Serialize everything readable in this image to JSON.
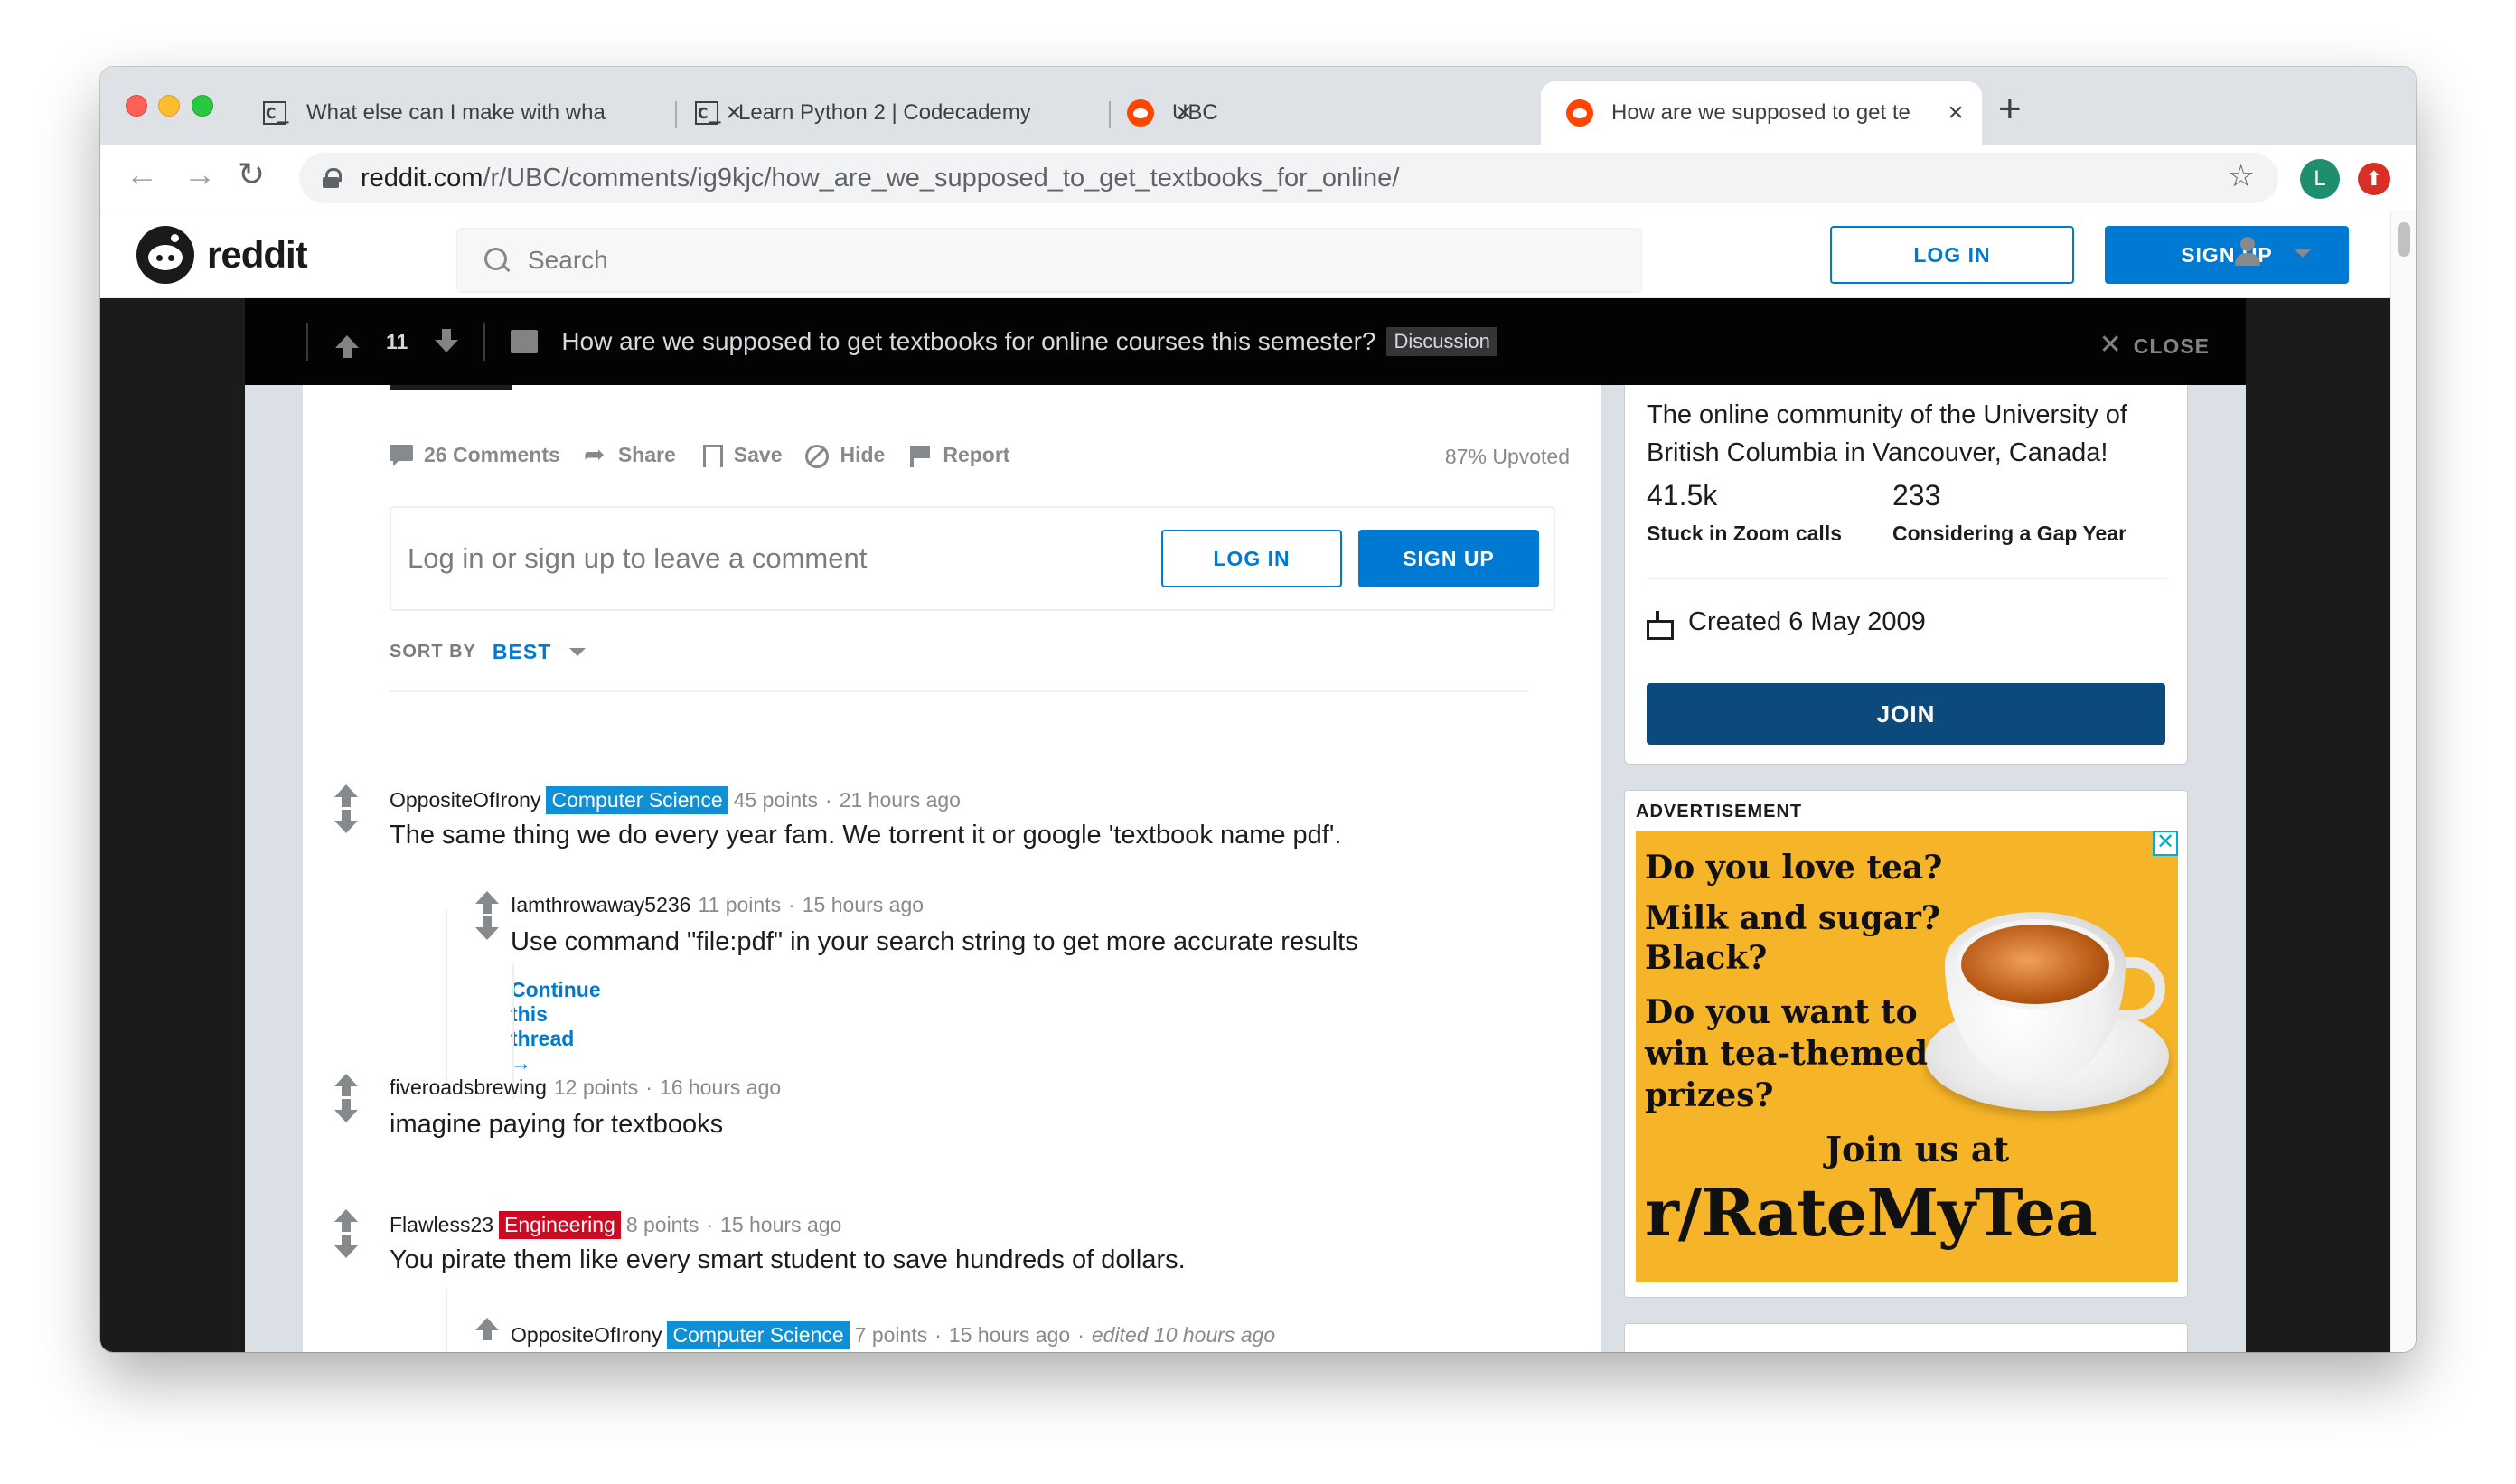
{
  "browser": {
    "tabs": [
      {
        "title": "What else can I make with wha",
        "favicon": "codecademy-icon",
        "active": false
      },
      {
        "title": "Learn Python 2 | Codecademy",
        "favicon": "codecademy-icon",
        "active": false
      },
      {
        "title": "UBC",
        "favicon": "reddit-icon",
        "active": false
      },
      {
        "title": "How are we supposed to get te",
        "favicon": "reddit-icon",
        "active": true
      }
    ],
    "favicon_text": "c_",
    "new_tab": "+",
    "url_host": "reddit.com",
    "url_path": "/r/UBC/comments/ig9kjc/how_are_we_supposed_to_get_textbooks_for_online/",
    "profile_initial": "L"
  },
  "header": {
    "logo_text": "reddit",
    "search_placeholder": "Search",
    "login_label": "LOG IN",
    "signup_label": "SIGN UP"
  },
  "post_bar": {
    "score": "11",
    "title": "How are we supposed to get textbooks for online courses this semester?",
    "flair": "Discussion",
    "close_label": "CLOSE"
  },
  "post_actions": {
    "comments": "26 Comments",
    "share": "Share",
    "save": "Save",
    "hide": "Hide",
    "report": "Report",
    "upvoted": "87% Upvoted"
  },
  "comment_prompt": {
    "placeholder": "Log in or sign up to leave a comment",
    "login_label": "LOG IN",
    "signup_label": "SIGN UP"
  },
  "sort": {
    "label": "SORT BY",
    "value": "BEST"
  },
  "comments": [
    {
      "user": "OppositeOfIrony",
      "flair": "Computer Science",
      "points": "45 points",
      "time": "21 hours ago",
      "body": "The same thing we do every year fam. We torrent it or google 'textbook name pdf'."
    },
    {
      "user": "Iamthrowaway5236",
      "flair": "",
      "points": "11 points",
      "time": "15 hours ago",
      "body": "Use command \"file:pdf\" in your search string to get more accurate results",
      "continue": "Continue this thread"
    },
    {
      "user": "fiveroadsbrewing",
      "flair": "",
      "points": "12 points",
      "time": "16 hours ago",
      "body": "imagine paying for textbooks"
    },
    {
      "user": "Flawless23",
      "flair": "Engineering",
      "points": "8 points",
      "time": "15 hours ago",
      "body": "You pirate them like every smart student to save hundreds of dollars."
    },
    {
      "user": "OppositeOfIrony",
      "flair": "Computer Science",
      "points": "7 points",
      "time": "15 hours ago",
      "edited": "edited 10 hours ago"
    }
  ],
  "sidebar": {
    "description": "The online community of the University of British Columbia in Vancouver, Canada!",
    "members": "41.5k",
    "members_label": "Stuck in Zoom calls",
    "online": "233",
    "online_label": "Considering a Gap Year",
    "created": "Created 6 May 2009",
    "join_label": "JOIN"
  },
  "ad": {
    "label": "ADVERTISEMENT",
    "close": "✕",
    "line1": "Do you love tea?",
    "line2": "Milk and sugar?",
    "line3": "Black?",
    "line4": "Do you want to",
    "line5": "win tea-themed",
    "line6": "prizes?",
    "line7": "Join us at",
    "line8": "r/RateMyTea"
  },
  "colors": {
    "reddit_blue": "#0079d3",
    "join_blue": "#0c4a7e",
    "cs_flair": "#0e8fd6",
    "eng_flair": "#cc0a23",
    "ad_background": "#f6b428"
  }
}
